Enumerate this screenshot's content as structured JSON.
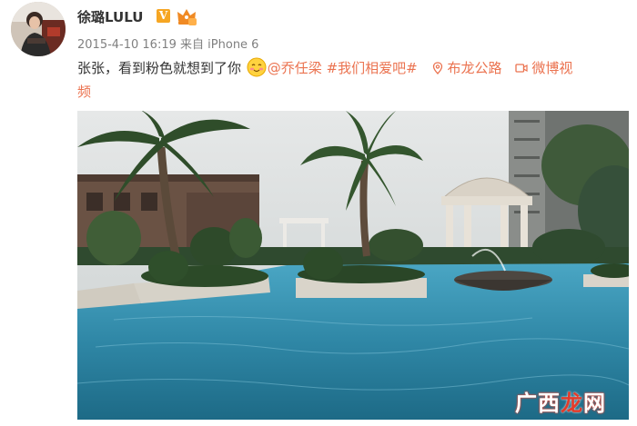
{
  "post": {
    "username": "徐璐LULU",
    "verified_badge": "V",
    "timestamp": "2015-4-10 16:19",
    "source_prefix": "来自",
    "source_device": "iPhone 6",
    "text_main": "张张，看到粉色就想到了你",
    "mention": "@乔任梁",
    "hashtag": "#我们相爱吧#",
    "location": "布龙公路",
    "video_label_part1": "微博视",
    "video_label_part2": "频"
  },
  "watermark": {
    "prefix": "广西",
    "accent": "龙",
    "suffix": "网"
  },
  "icons": {
    "member": "crown-member-icon",
    "emoji": "shy-smile-emoji-icon",
    "location": "location-pin-icon",
    "video": "video-camera-icon"
  },
  "colors": {
    "link": "#eb7350",
    "verified": "#f6a623",
    "meta": "#808080",
    "text": "#333333"
  }
}
